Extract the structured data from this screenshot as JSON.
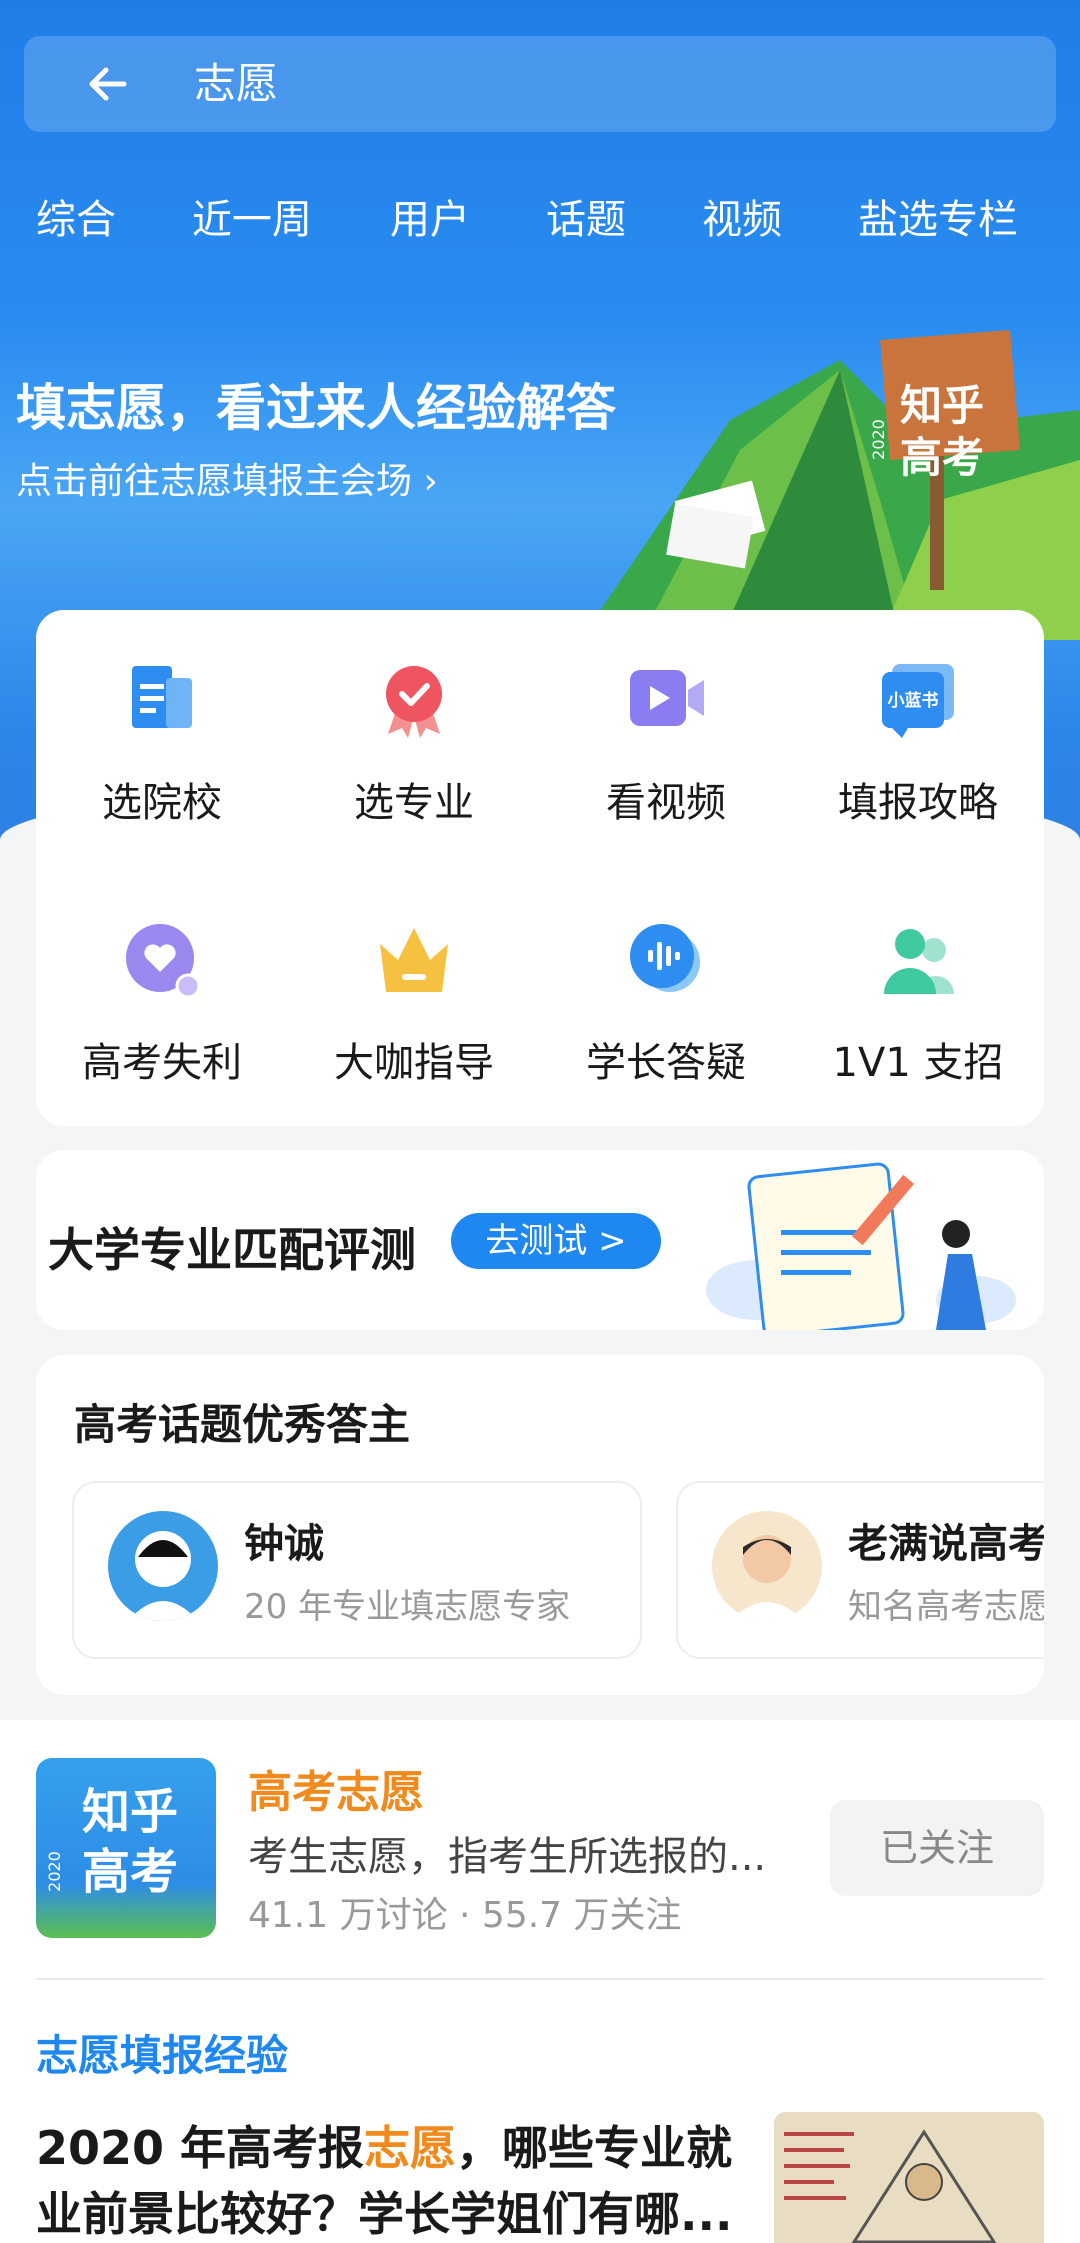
{
  "search": {
    "query": "志愿"
  },
  "tabs": [
    {
      "label": "综合"
    },
    {
      "label": "近一周"
    },
    {
      "label": "用户"
    },
    {
      "label": "话题"
    },
    {
      "label": "视频"
    },
    {
      "label": "盐选专栏"
    }
  ],
  "banner": {
    "title": "填志愿，看过来人经验解答",
    "subtitle": "点击前往志愿填报主会场 ›",
    "badge_text": "知乎高考",
    "badge_year": "2020"
  },
  "grid": [
    {
      "label": "选院校",
      "icon": "school-doc-icon"
    },
    {
      "label": "选专业",
      "icon": "medal-icon"
    },
    {
      "label": "看视频",
      "icon": "video-icon"
    },
    {
      "label": "填报攻略",
      "icon": "little-blue-book-icon",
      "icon_text": "小蓝书"
    },
    {
      "label": "高考失利",
      "icon": "heart-bubble-icon"
    },
    {
      "label": "大咖指导",
      "icon": "crown-icon"
    },
    {
      "label": "学长答疑",
      "icon": "voice-bubble-icon"
    },
    {
      "label": "1V1 支招",
      "icon": "users-icon"
    }
  ],
  "test_banner": {
    "title": "大学专业匹配评测",
    "button": "去测试 >"
  },
  "answerers": {
    "title": "高考话题优秀答主",
    "items": [
      {
        "name": "钟诚",
        "desc": "20 年专业填志愿专家"
      },
      {
        "name": "老满说高考",
        "desc": "知名高考志愿"
      }
    ]
  },
  "topic": {
    "name": "高考志愿",
    "desc": "考生志愿，指考生所选报的...",
    "stats": "41.1 万讨论 · 55.7 万关注",
    "follow_label": "已关注",
    "image_text": "知乎高考",
    "image_year": "2020"
  },
  "section": {
    "heading": "志愿填报经验"
  },
  "article": {
    "title_pre": "2020 年高考报",
    "title_hl": "志愿",
    "title_post": "，哪些专业就业前景比较好？学长学姐们有哪..."
  },
  "colors": {
    "brand_blue": "#1e88f0",
    "accent_orange": "#f08a1c"
  }
}
